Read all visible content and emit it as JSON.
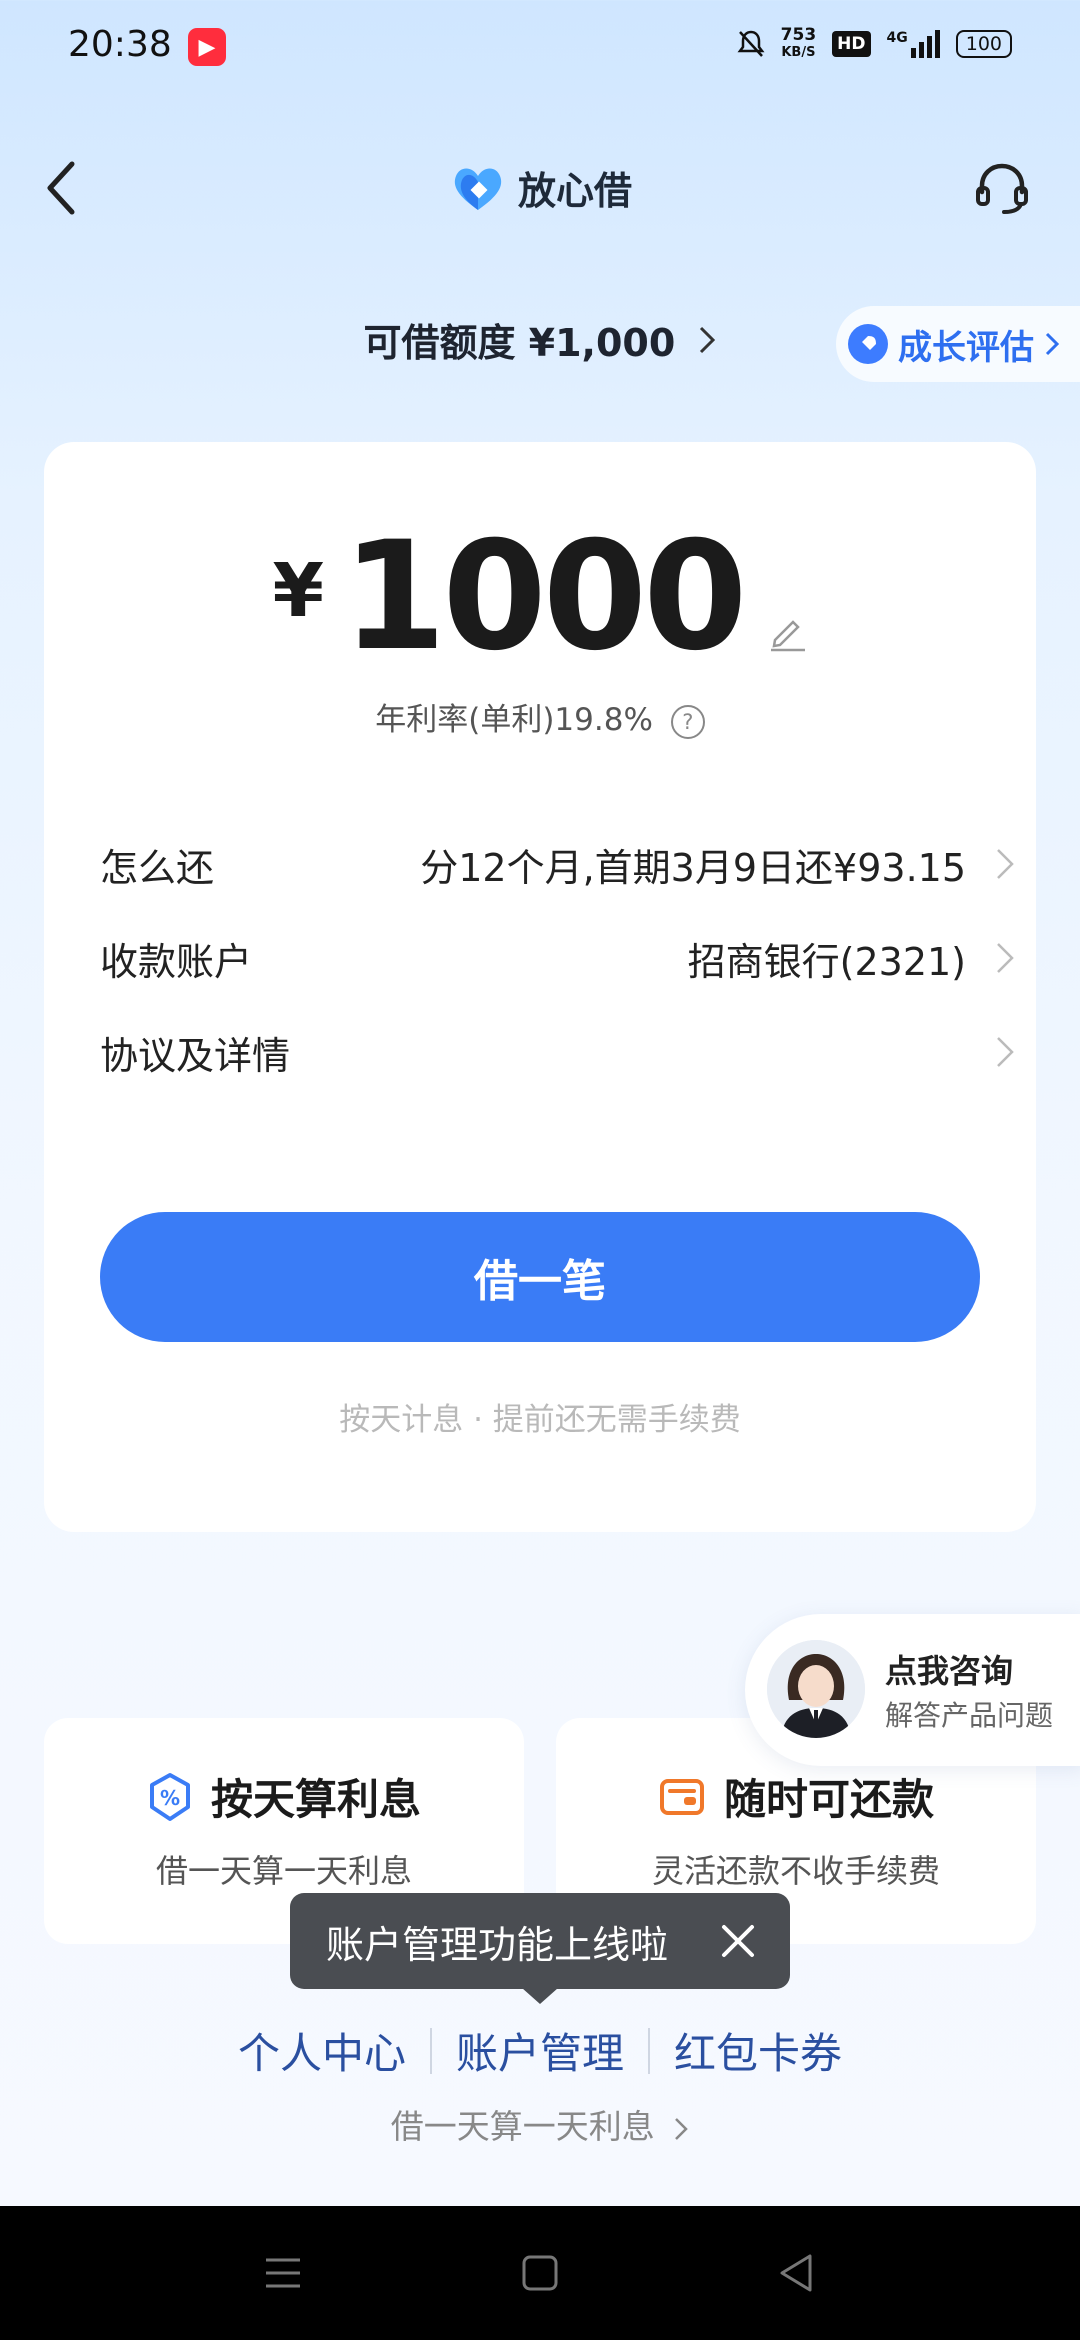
{
  "status_bar": {
    "time": "20:38",
    "net_speed_value": "753",
    "net_speed_unit": "KB/S",
    "hd": "HD",
    "signal": "4G",
    "battery": "100"
  },
  "header": {
    "brand": "放心借",
    "back_icon": "back-arrow-icon",
    "service_icon": "headset-icon"
  },
  "credit": {
    "label": "可借额度 ¥1,000",
    "growth_label": "成长评估"
  },
  "loan": {
    "currency": "¥",
    "amount": "1000",
    "rate_label": "年利率(单利)19.8%",
    "rows": [
      {
        "label": "怎么还",
        "value": "分12个月,首期3月9日还¥93.15"
      },
      {
        "label": "收款账户",
        "value": "招商银行(2321)"
      },
      {
        "label": "协议及详情",
        "value": ""
      }
    ],
    "borrow_button": "借一笔",
    "fee_note": "按天计息 · 提前还无需手续费"
  },
  "consult": {
    "title": "点我咨询",
    "subtitle": "解答产品问题"
  },
  "features": [
    {
      "title": "按天算利息",
      "subtitle": "借一天算一天利息"
    },
    {
      "title": "随时可还款",
      "subtitle": "灵活还款不收手续费"
    }
  ],
  "tooltip": {
    "text": "账户管理功能上线啦"
  },
  "links": [
    "个人中心",
    "账户管理",
    "红包卡券"
  ],
  "bottom_note": "借一天算一天利息",
  "colors": {
    "primary": "#3a7cf6",
    "link": "#2a4fa0",
    "tooltip_bg": "#4a4d52",
    "feature_icon_orange": "#f0782a"
  }
}
